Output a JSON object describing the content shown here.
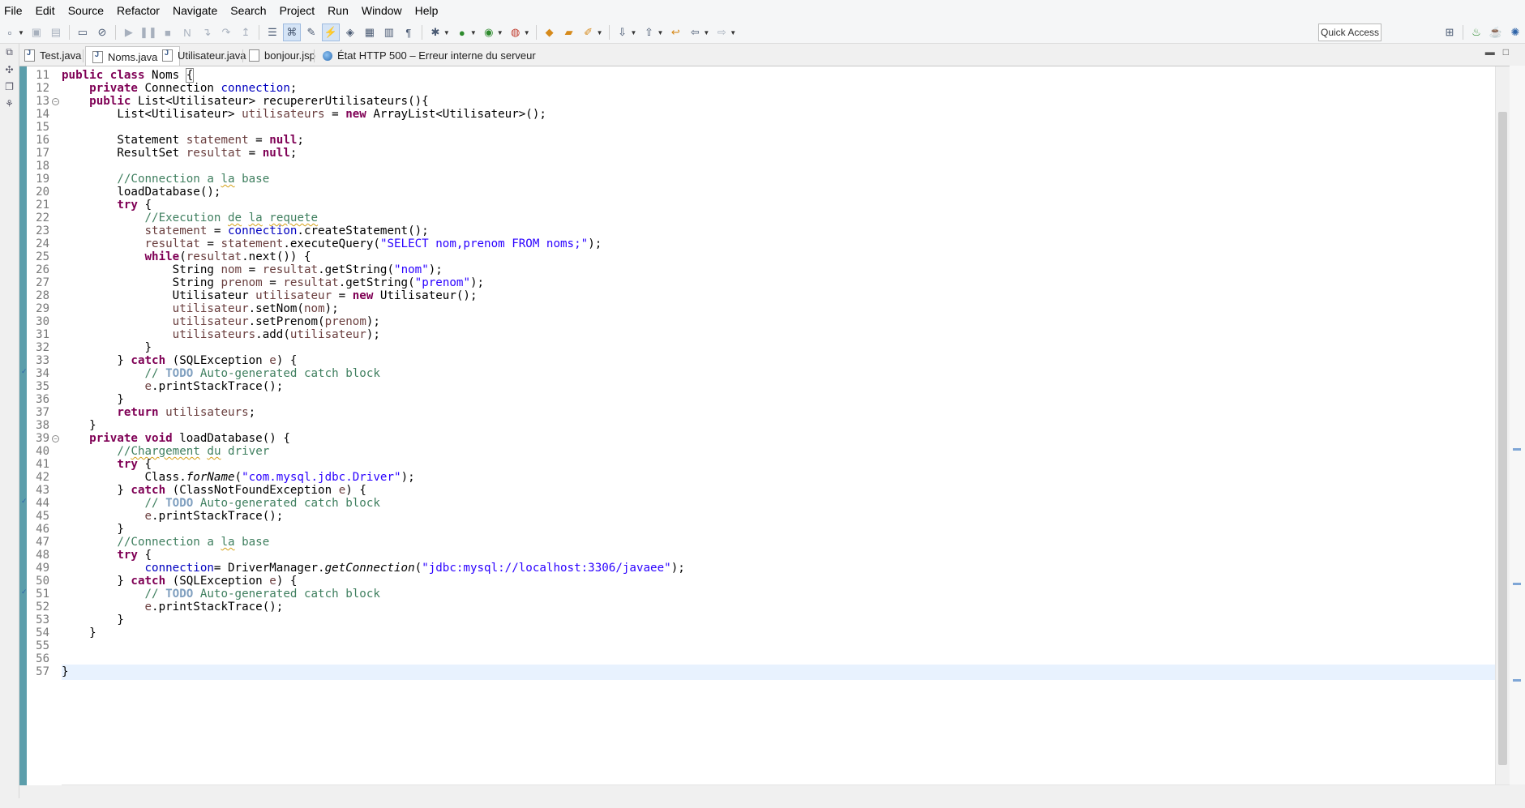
{
  "menu": [
    "File",
    "Edit",
    "Source",
    "Refactor",
    "Navigate",
    "Search",
    "Project",
    "Run",
    "Window",
    "Help"
  ],
  "toolbar": {
    "quick_access": "Quick Access"
  },
  "tabs": [
    {
      "label": "Test.java",
      "icon": "java-file-icon",
      "active": false
    },
    {
      "label": "Noms.java",
      "icon": "java-file-icon",
      "active": true
    },
    {
      "label": "Utilisateur.java",
      "icon": "java-file-icon",
      "active": false
    },
    {
      "label": "bonjour.jsp",
      "icon": "jsp-file-icon",
      "active": false
    },
    {
      "label": "État HTTP 500 – Erreur interne du serveur",
      "icon": "globe-icon",
      "active": false
    }
  ],
  "editor": {
    "first_line": 11,
    "current_line": 57,
    "fold_lines": [
      13,
      39
    ],
    "task_lines": [
      34,
      44,
      51
    ]
  },
  "colors": {
    "keyword": "#7f0055",
    "field": "#0000c0",
    "local_variable": "#6a3e3e",
    "comment": "#3f7f5f",
    "string": "#2a00ff",
    "ruler": "#5c9eab",
    "current_line": "#e8f2fe"
  }
}
